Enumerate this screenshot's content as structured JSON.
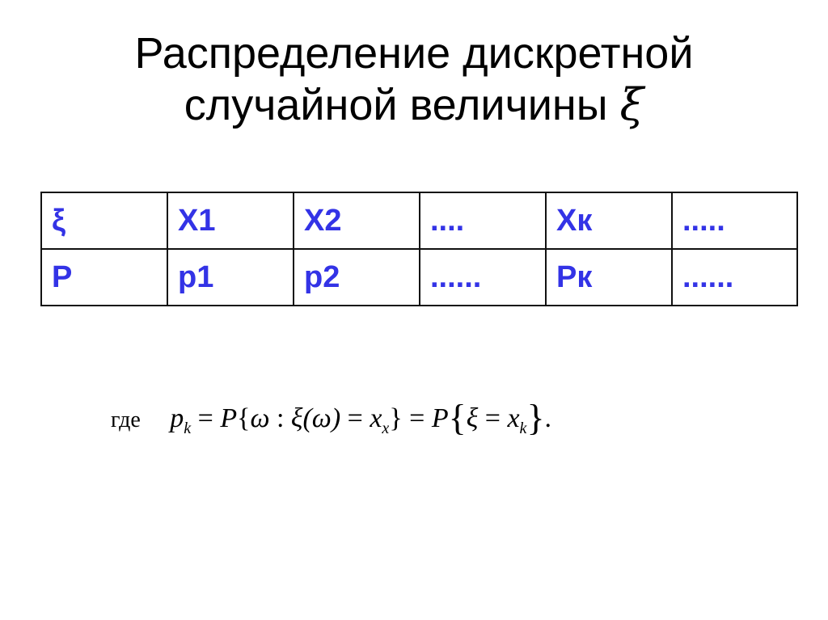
{
  "slide": {
    "title_line1": "Распределение дискретной",
    "title_line2": "случайной величины",
    "title_symbol": "ξ"
  },
  "table": {
    "rows": [
      [
        "ξ",
        "X1",
        "X2",
        "....",
        "Xк",
        "....."
      ],
      [
        "P",
        "p1",
        "p2",
        "......",
        "Pк",
        "......"
      ]
    ],
    "text_color": "#3333e6"
  },
  "formula": {
    "prefix_word": "где",
    "lhs_var": "p",
    "lhs_sub": "k",
    "eq": "=",
    "prob": "P",
    "open_brace": "{",
    "omega": "ω",
    "colon": " : ",
    "xi": "ξ",
    "xi_arg": "(ω)",
    "x_var": "x",
    "x_sub1": "x",
    "close_brace": "}",
    "x_sub2": "k",
    "end": "."
  }
}
